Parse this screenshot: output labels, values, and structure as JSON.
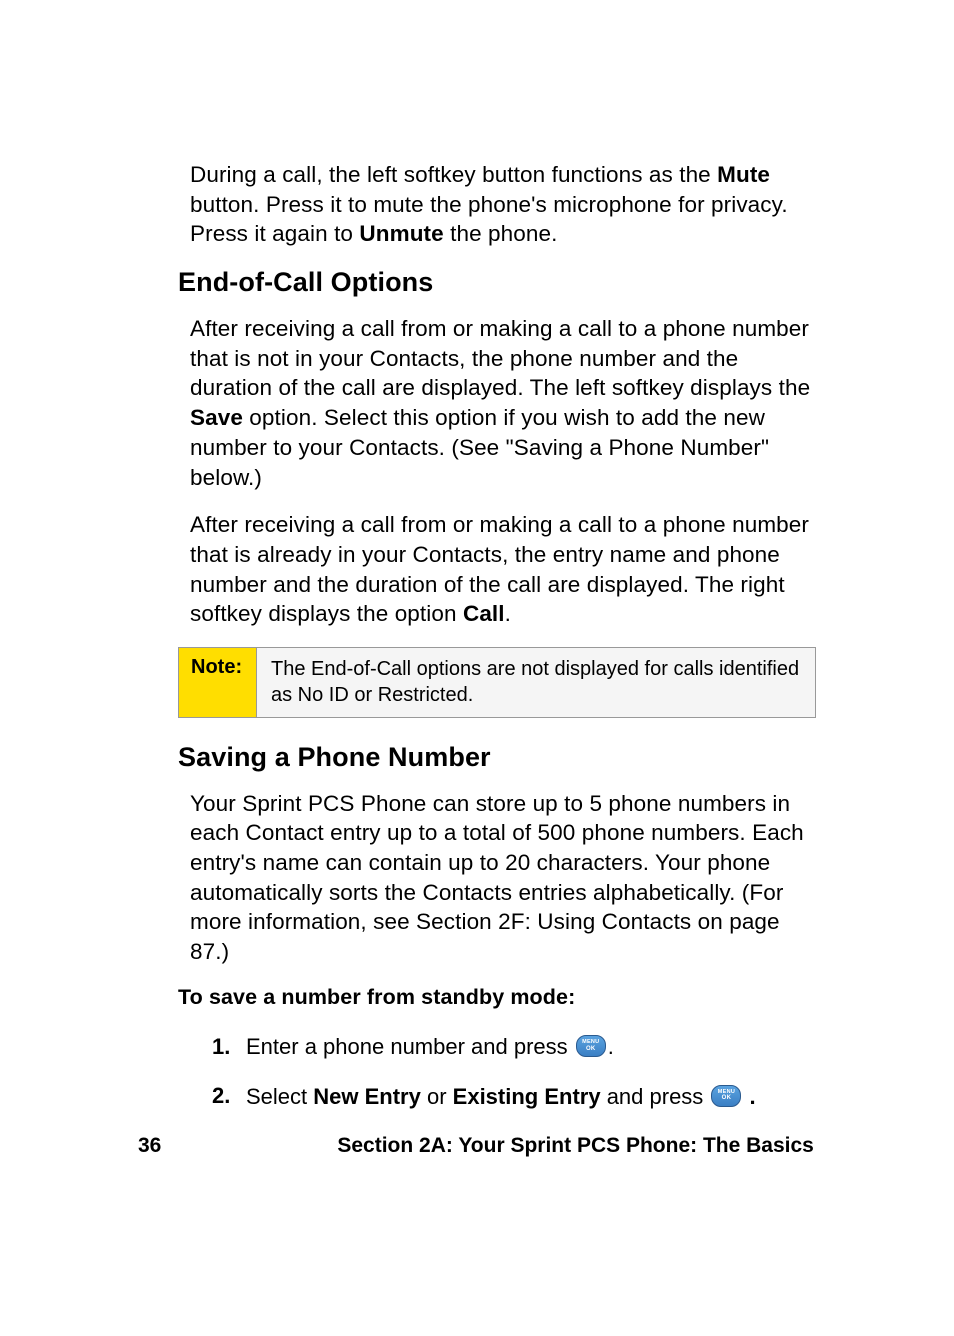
{
  "para1": {
    "pre": "During a call, the left softkey button functions as the ",
    "bold1": "Mute",
    "mid": " button. Press it to mute the phone's microphone for privacy. Press it again to ",
    "bold2": "Unmute",
    "post": " the phone."
  },
  "heading1": "End-of-Call Options",
  "para2": {
    "pre": "After receiving a call from or making a call to a phone number that is not in your Contacts, the phone number and the duration of the call are displayed. The left softkey displays the ",
    "bold1": "Save",
    "post": " option. Select this option if you wish to add the new number to your Contacts. (See \"Saving a Phone Number\" below.)"
  },
  "para3": {
    "pre": "After receiving a call from or making a call to a phone number that is already in your Contacts, the entry name and phone number and the duration of the call are displayed. The right softkey displays the option ",
    "bold1": "Call",
    "post": "."
  },
  "note": {
    "label": "Note:",
    "text": "The End-of-Call options are not displayed for calls identified as No ID or Restricted."
  },
  "heading2": "Saving a Phone Number",
  "para4": "Your Sprint PCS Phone can store up to 5 phone numbers in each Contact entry up to a total of 500 phone numbers. Each entry's name can contain up to 20 characters. Your phone automatically sorts the Contacts entries alphabetically. (For more information, see Section 2F: Using Contacts on page 87.)",
  "instruction": "To save a number from standby mode:",
  "steps": [
    {
      "num": "1.",
      "pre": "Enter a phone number and press ",
      "post": "."
    },
    {
      "num": "2.",
      "pre": "Select ",
      "bold1": "New Entry",
      "mid": " or ",
      "bold2": "Existing Entry",
      "mid2": " and press ",
      "postBold": " ."
    }
  ],
  "menuKey": {
    "line1": "MENU",
    "line2": "OK"
  },
  "footer": {
    "pageNum": "36",
    "title": "Section 2A: Your Sprint PCS Phone: The Basics"
  }
}
